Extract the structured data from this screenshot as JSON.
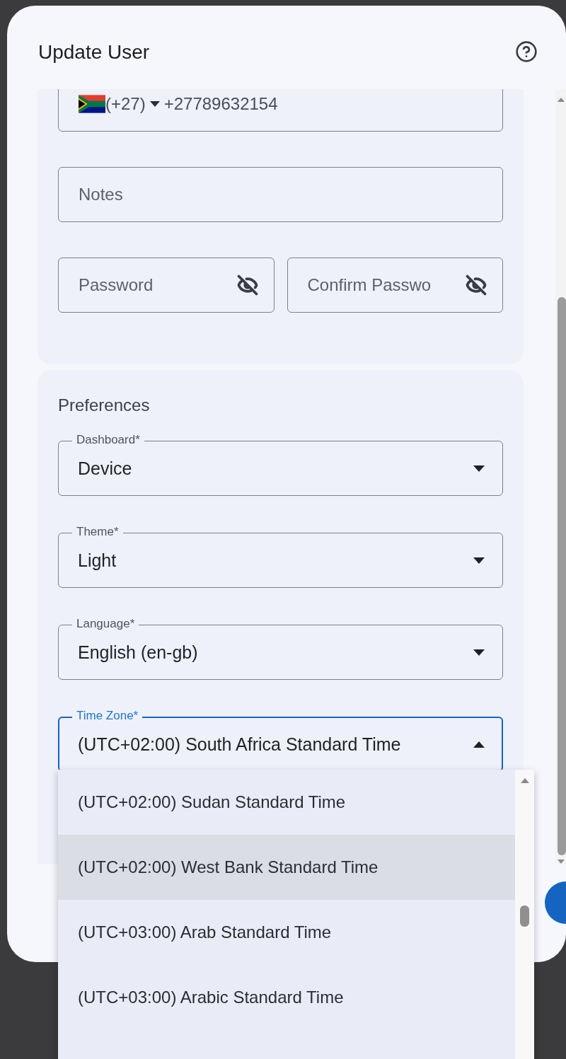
{
  "dialog": {
    "title": "Update User"
  },
  "contact": {
    "phone": {
      "country_code": "(+27)",
      "value": "+27789632154"
    },
    "notes": {
      "placeholder": "Notes"
    },
    "password": {
      "placeholder": "Password"
    },
    "confirm_password": {
      "placeholder": "Confirm Passwo"
    }
  },
  "preferences": {
    "title": "Preferences",
    "selects": [
      {
        "label": "Dashboard*",
        "value": "Device",
        "focused": false,
        "expanded": false
      },
      {
        "label": "Theme*",
        "value": "Light",
        "focused": false,
        "expanded": false
      },
      {
        "label": "Language*",
        "value": "English (en-gb)",
        "focused": false,
        "expanded": false
      },
      {
        "label": "Time Zone*",
        "value": "(UTC+02:00) South Africa Standard Time",
        "focused": true,
        "expanded": true
      }
    ]
  },
  "time_zone_options": [
    {
      "label": "(UTC+02:00) Sudan Standard Time",
      "highlighted": false
    },
    {
      "label": "(UTC+02:00) West Bank Standard Time",
      "highlighted": true
    },
    {
      "label": "(UTC+03:00) Arab Standard Time",
      "highlighted": false
    },
    {
      "label": "(UTC+03:00) Arabic Standard Time",
      "highlighted": false
    }
  ]
}
